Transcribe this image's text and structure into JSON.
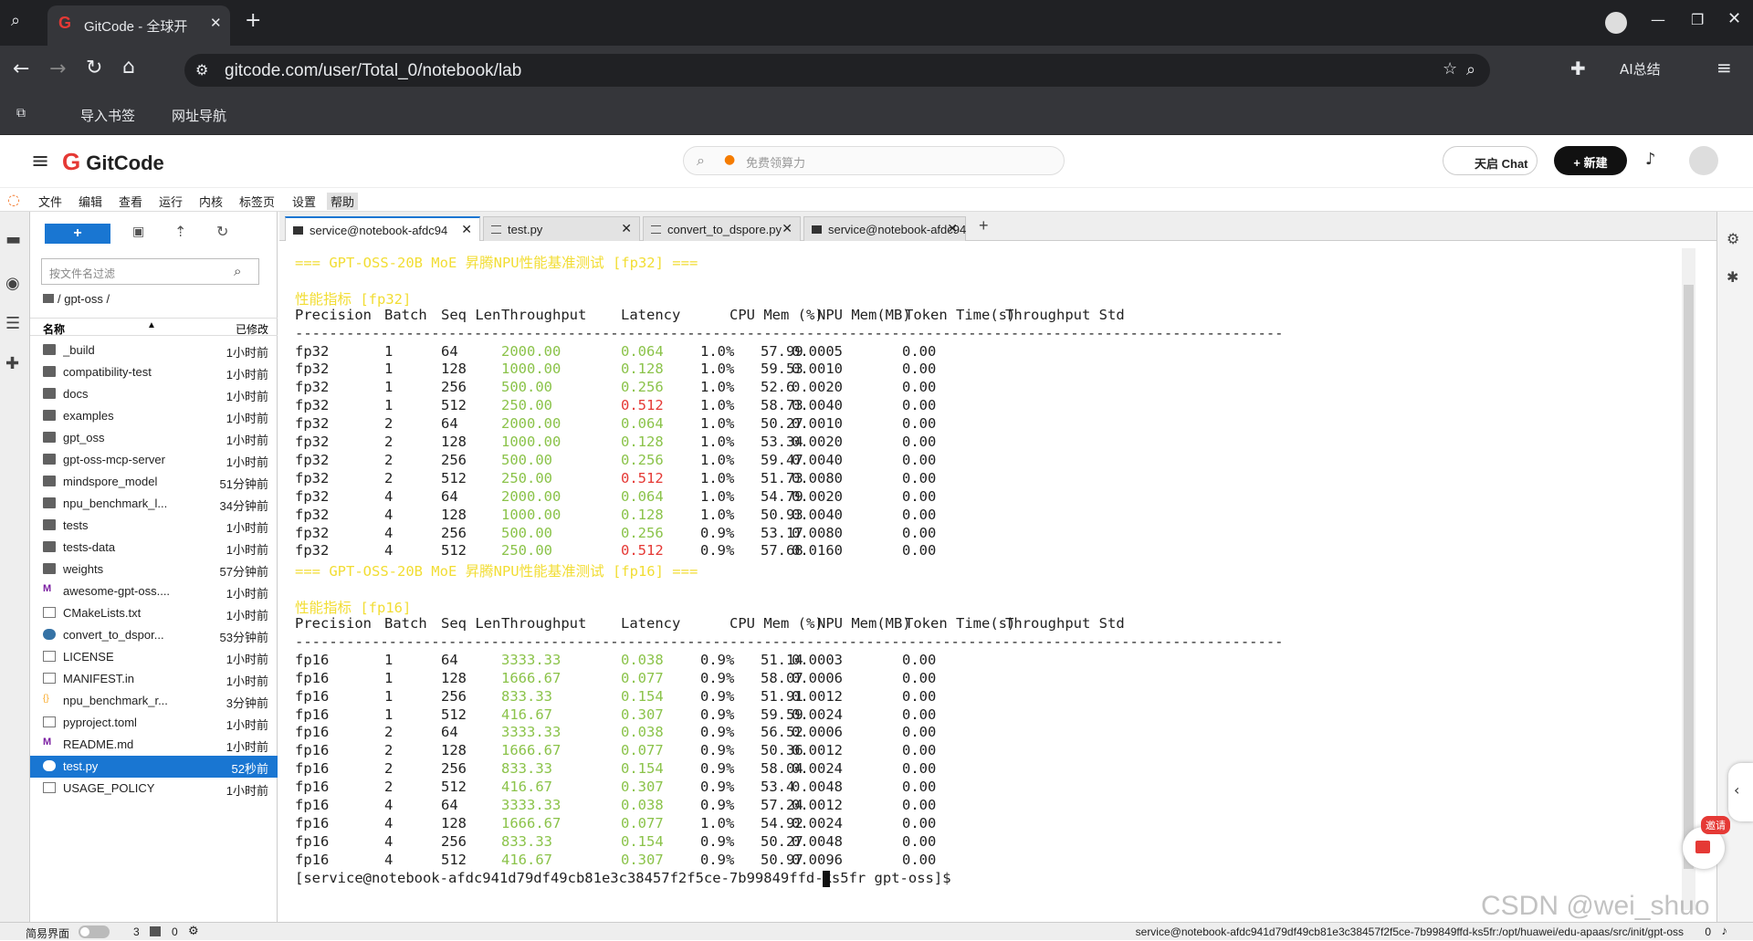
{
  "browser": {
    "tab_title": "GitCode - 全球开",
    "url": "gitcode.com/user/Total_0/notebook/lab",
    "bookmark_import": "导入书签",
    "bookmark_nav": "网址导航",
    "ai_summary": "AI总结"
  },
  "site": {
    "logo_text": "GitCode",
    "search_placeholder": "免费领算力",
    "chat_label": "天启 Chat",
    "new_label": "+ 新建"
  },
  "menu": [
    "文件",
    "编辑",
    "查看",
    "运行",
    "内核",
    "标签页",
    "设置",
    "帮助"
  ],
  "filebrowser": {
    "new_label": "+",
    "filter_placeholder": "按文件名过滤",
    "breadcrumb": "/ gpt-oss /",
    "col_name": "名称",
    "col_modified": "已修改",
    "files": [
      {
        "name": "_build",
        "modified": "1小时前",
        "kind": "folder"
      },
      {
        "name": "compatibility-test",
        "modified": "1小时前",
        "kind": "folder"
      },
      {
        "name": "docs",
        "modified": "1小时前",
        "kind": "folder"
      },
      {
        "name": "examples",
        "modified": "1小时前",
        "kind": "folder"
      },
      {
        "name": "gpt_oss",
        "modified": "1小时前",
        "kind": "folder"
      },
      {
        "name": "gpt-oss-mcp-server",
        "modified": "1小时前",
        "kind": "folder"
      },
      {
        "name": "mindspore_model",
        "modified": "51分钟前",
        "kind": "folder"
      },
      {
        "name": "npu_benchmark_l...",
        "modified": "34分钟前",
        "kind": "folder"
      },
      {
        "name": "tests",
        "modified": "1小时前",
        "kind": "folder"
      },
      {
        "name": "tests-data",
        "modified": "1小时前",
        "kind": "folder"
      },
      {
        "name": "weights",
        "modified": "57分钟前",
        "kind": "folder"
      },
      {
        "name": "awesome-gpt-oss....",
        "modified": "1小时前",
        "kind": "markdown"
      },
      {
        "name": "CMakeLists.txt",
        "modified": "1小时前",
        "kind": "file"
      },
      {
        "name": "convert_to_dspor...",
        "modified": "53分钟前",
        "kind": "python"
      },
      {
        "name": "LICENSE",
        "modified": "1小时前",
        "kind": "file"
      },
      {
        "name": "MANIFEST.in",
        "modified": "1小时前",
        "kind": "file"
      },
      {
        "name": "npu_benchmark_r...",
        "modified": "3分钟前",
        "kind": "json"
      },
      {
        "name": "pyproject.toml",
        "modified": "1小时前",
        "kind": "file"
      },
      {
        "name": "README.md",
        "modified": "1小时前",
        "kind": "markdown"
      },
      {
        "name": "test.py",
        "modified": "52秒前",
        "kind": "python",
        "selected": true
      },
      {
        "name": "USAGE_POLICY",
        "modified": "1小时前",
        "kind": "file"
      }
    ]
  },
  "doc_tabs": [
    {
      "label": "service@notebook-afdc94",
      "active": true,
      "kind": "terminal"
    },
    {
      "label": "test.py",
      "active": false,
      "kind": "text"
    },
    {
      "label": "convert_to_dspore.py",
      "active": false,
      "kind": "text"
    },
    {
      "label": "service@notebook-afdc94",
      "active": false,
      "kind": "terminal"
    }
  ],
  "terminal": {
    "header_cols": [
      "Precision",
      "Batch",
      "Seq Len",
      "Throughput",
      "Latency",
      "CPU Mem (%)",
      "NPU Mem(MB)",
      "Token Time(s)",
      "Throughput Std"
    ],
    "divider": "--------------------------------------------------------------------------------------------------------------------",
    "sections": [
      {
        "banner": "=== GPT-OSS-20B MoE 昇腾NPU性能基准测试 [fp32] ===",
        "metrics_title": "性能指标 [fp32]",
        "rows": [
          [
            "fp32",
            "1",
            "64",
            "2000.00",
            "0.064",
            "1.0%",
            "57.99",
            "0.0005",
            "0.00"
          ],
          [
            "fp32",
            "1",
            "128",
            "1000.00",
            "0.128",
            "1.0%",
            "59.53",
            "0.0010",
            "0.00"
          ],
          [
            "fp32",
            "1",
            "256",
            "500.00",
            "0.256",
            "1.0%",
            "52.6",
            "0.0020",
            "0.00"
          ],
          [
            "fp32",
            "1",
            "512",
            "250.00",
            "0.512",
            "1.0%",
            "58.73",
            "0.0040",
            "0.00"
          ],
          [
            "fp32",
            "2",
            "64",
            "2000.00",
            "0.064",
            "1.0%",
            "50.27",
            "0.0010",
            "0.00"
          ],
          [
            "fp32",
            "2",
            "128",
            "1000.00",
            "0.128",
            "1.0%",
            "53.34",
            "0.0020",
            "0.00"
          ],
          [
            "fp32",
            "2",
            "256",
            "500.00",
            "0.256",
            "1.0%",
            "59.47",
            "0.0040",
            "0.00"
          ],
          [
            "fp32",
            "2",
            "512",
            "250.00",
            "0.512",
            "1.0%",
            "51.73",
            "0.0080",
            "0.00"
          ],
          [
            "fp32",
            "4",
            "64",
            "2000.00",
            "0.064",
            "1.0%",
            "54.79",
            "0.0020",
            "0.00"
          ],
          [
            "fp32",
            "4",
            "128",
            "1000.00",
            "0.128",
            "1.0%",
            "50.93",
            "0.0040",
            "0.00"
          ],
          [
            "fp32",
            "4",
            "256",
            "500.00",
            "0.256",
            "0.9%",
            "53.17",
            "0.0080",
            "0.00"
          ],
          [
            "fp32",
            "4",
            "512",
            "250.00",
            "0.512",
            "0.9%",
            "57.68",
            "0.0160",
            "0.00"
          ]
        ]
      },
      {
        "banner": "=== GPT-OSS-20B MoE 昇腾NPU性能基准测试 [fp16] ===",
        "metrics_title": "性能指标 [fp16]",
        "rows": [
          [
            "fp16",
            "1",
            "64",
            "3333.33",
            "0.038",
            "0.9%",
            "51.14",
            "0.0003",
            "0.00"
          ],
          [
            "fp16",
            "1",
            "128",
            "1666.67",
            "0.077",
            "0.9%",
            "58.07",
            "0.0006",
            "0.00"
          ],
          [
            "fp16",
            "1",
            "256",
            "833.33",
            "0.154",
            "0.9%",
            "51.91",
            "0.0012",
            "0.00"
          ],
          [
            "fp16",
            "1",
            "512",
            "416.67",
            "0.307",
            "0.9%",
            "59.59",
            "0.0024",
            "0.00"
          ],
          [
            "fp16",
            "2",
            "64",
            "3333.33",
            "0.038",
            "0.9%",
            "56.52",
            "0.0006",
            "0.00"
          ],
          [
            "fp16",
            "2",
            "128",
            "1666.67",
            "0.077",
            "0.9%",
            "50.36",
            "0.0012",
            "0.00"
          ],
          [
            "fp16",
            "2",
            "256",
            "833.33",
            "0.154",
            "0.9%",
            "58.04",
            "0.0024",
            "0.00"
          ],
          [
            "fp16",
            "2",
            "512",
            "416.67",
            "0.307",
            "0.9%",
            "53.4",
            "0.0048",
            "0.00"
          ],
          [
            "fp16",
            "4",
            "64",
            "3333.33",
            "0.038",
            "0.9%",
            "57.24",
            "0.0012",
            "0.00"
          ],
          [
            "fp16",
            "4",
            "128",
            "1666.67",
            "0.077",
            "1.0%",
            "54.92",
            "0.0024",
            "0.00"
          ],
          [
            "fp16",
            "4",
            "256",
            "833.33",
            "0.154",
            "0.9%",
            "50.27",
            "0.0048",
            "0.00"
          ],
          [
            "fp16",
            "4",
            "512",
            "416.67",
            "0.307",
            "0.9%",
            "50.97",
            "0.0096",
            "0.00"
          ]
        ]
      }
    ],
    "prompt": "[service@notebook-afdc941d79df49cb81e3c38457f2f5ce-7b99849ffd-ks5fr gpt-oss]$"
  },
  "status": {
    "simple_mode": "简易界面",
    "count_a": "3",
    "count_b": "0",
    "path": "service@notebook-afdc941d79df49cb81e3c38457f2f5ce-7b99849ffd-ks5fr:/opt/huawei/edu-apaas/src/init/gpt-oss",
    "right_count": "0"
  },
  "overlays": {
    "invite": "邀请",
    "watermark": "CSDN @wei_shuo"
  }
}
